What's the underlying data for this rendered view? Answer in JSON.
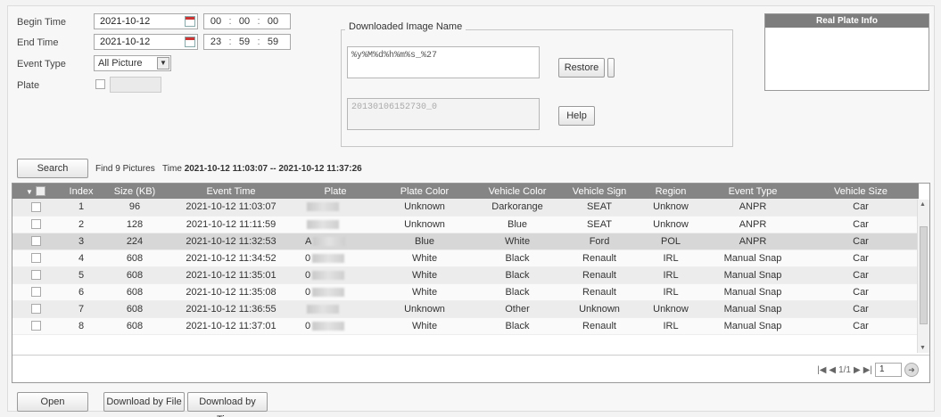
{
  "form": {
    "begin_time_label": "Begin Time",
    "begin_date": "2021-10-12",
    "begin_h": "00",
    "begin_m": "00",
    "begin_s": "00",
    "end_time_label": "End Time",
    "end_date": "2021-10-12",
    "end_h": "23",
    "end_m": "59",
    "end_s": "59",
    "event_type_label": "Event Type",
    "event_type_value": "All Picture",
    "plate_label": "Plate",
    "time_sep": ":"
  },
  "download_group": {
    "title": "Downloaded Image Name",
    "pattern": "%y%M%d%h%m%s_%27",
    "sample": "20130106152730_0",
    "restore_label": "Restore",
    "help_label": "Help"
  },
  "plate_panel": {
    "title": "Real Plate Info"
  },
  "search": {
    "button_label": "Search",
    "find_text": "Find 9 Pictures",
    "time_prefix": "Time",
    "time_range": "2021-10-12 11:03:07 -- 2021-10-12 11:37:26"
  },
  "table": {
    "columns": [
      "Index",
      "Size (KB)",
      "Event Time",
      "Plate",
      "Plate Color",
      "Vehicle Color",
      "Vehicle Sign",
      "Region",
      "Event Type",
      "Vehicle Size"
    ],
    "rows": [
      {
        "index": "1",
        "size": "96",
        "time": "2021-10-12 11:03:07",
        "plate": "",
        "plate_color": "Unknown",
        "vehicle_color": "Darkorange",
        "sign": "SEAT",
        "region": "Unknow",
        "event": "ANPR",
        "vsize": "Car"
      },
      {
        "index": "2",
        "size": "128",
        "time": "2021-10-12 11:11:59",
        "plate": "",
        "plate_color": "Unknown",
        "vehicle_color": "Blue",
        "sign": "SEAT",
        "region": "Unknow",
        "event": "ANPR",
        "vsize": "Car"
      },
      {
        "index": "3",
        "size": "224",
        "time": "2021-10-12 11:32:53",
        "plate": "A",
        "plate_color": "Blue",
        "vehicle_color": "White",
        "sign": "Ford",
        "region": "POL",
        "event": "ANPR",
        "vsize": "Car"
      },
      {
        "index": "4",
        "size": "608",
        "time": "2021-10-12 11:34:52",
        "plate": "0",
        "plate_color": "White",
        "vehicle_color": "Black",
        "sign": "Renault",
        "region": "IRL",
        "event": "Manual Snap",
        "vsize": "Car"
      },
      {
        "index": "5",
        "size": "608",
        "time": "2021-10-12 11:35:01",
        "plate": "0",
        "plate_color": "White",
        "vehicle_color": "Black",
        "sign": "Renault",
        "region": "IRL",
        "event": "Manual Snap",
        "vsize": "Car"
      },
      {
        "index": "6",
        "size": "608",
        "time": "2021-10-12 11:35:08",
        "plate": "0",
        "plate_color": "White",
        "vehicle_color": "Black",
        "sign": "Renault",
        "region": "IRL",
        "event": "Manual Snap",
        "vsize": "Car"
      },
      {
        "index": "7",
        "size": "608",
        "time": "2021-10-12 11:36:55",
        "plate": "",
        "plate_color": "Unknown",
        "vehicle_color": "Other",
        "sign": "Unknown",
        "region": "Unknow",
        "event": "Manual Snap",
        "vsize": "Car"
      },
      {
        "index": "8",
        "size": "608",
        "time": "2021-10-12 11:37:01",
        "plate": "0",
        "plate_color": "White",
        "vehicle_color": "Black",
        "sign": "Renault",
        "region": "IRL",
        "event": "Manual Snap",
        "vsize": "Car"
      }
    ]
  },
  "pager": {
    "page_text": "1/1",
    "page_input": "1"
  },
  "bottom": {
    "open_label": "Open",
    "download_file_label": "Download by File",
    "download_time_label": "Download by Time"
  }
}
